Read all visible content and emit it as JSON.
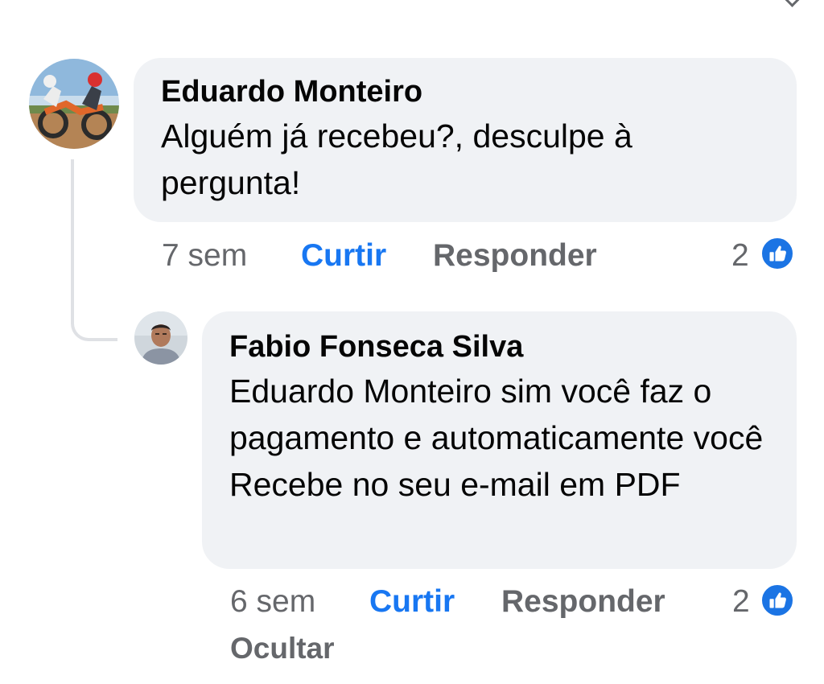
{
  "comments": [
    {
      "author": "Eduardo Monteiro",
      "text": "Alguém já recebeu?, desculpe à pergunta!",
      "time": "7 sem",
      "like_label": "Curtir",
      "reply_label": "Responder",
      "reaction_count": "2"
    },
    {
      "author": "Fabio Fonseca Silva",
      "text": "Eduardo Monteiro sim você faz o pagamento e automaticamente você Recebe no  seu e-mail em PDF",
      "time": "6 sem",
      "like_label": "Curtir",
      "reply_label": "Responder",
      "reaction_count": "2",
      "hide_label": "Ocultar"
    }
  ],
  "icons": {
    "reaction": "like-thumb-icon",
    "avatar_1": "motocross-photo",
    "avatar_2": "person-photo"
  },
  "colors": {
    "bubble": "#f0f2f5",
    "link_blue": "#1877f2",
    "meta_gray": "#65676b"
  }
}
